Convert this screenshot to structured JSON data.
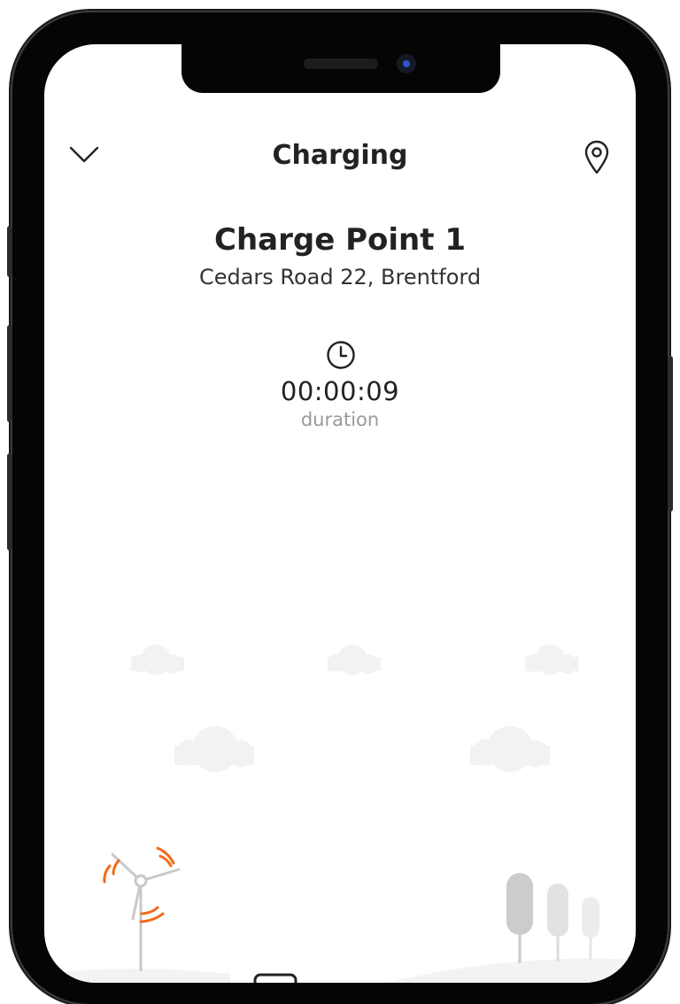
{
  "header": {
    "title": "Charging",
    "back_icon": "chevron-down-icon",
    "location_icon": "map-pin-icon"
  },
  "station": {
    "name": "Charge Point 1",
    "address": "Cedars Road 22, Brentford"
  },
  "session": {
    "duration_icon": "clock-icon",
    "duration_value": "00:00:09",
    "duration_label": "duration"
  },
  "colors": {
    "accent": "#f26a1b",
    "text": "#222222",
    "muted": "#9a9a9a",
    "cloud": "#f2f2f2",
    "hill": "#f3f3f3"
  }
}
